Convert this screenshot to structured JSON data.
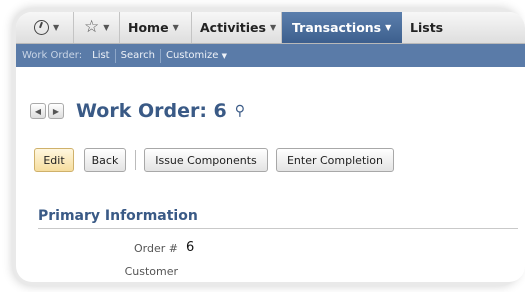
{
  "nav": {
    "items": [
      {
        "label": "Home"
      },
      {
        "label": "Activities"
      },
      {
        "label": "Transactions"
      },
      {
        "label": "Lists"
      }
    ]
  },
  "subnav": {
    "context_label": "Work Order:",
    "links": [
      "List",
      "Search",
      "Customize"
    ]
  },
  "record": {
    "title": "Work Order: 6"
  },
  "actions": {
    "edit": "Edit",
    "back": "Back",
    "issue_components": "Issue Components",
    "enter_completion": "Enter Completion"
  },
  "section": {
    "title": "Primary Information",
    "fields": [
      {
        "label": "Order #",
        "value": "6"
      },
      {
        "label": "Customer",
        "value": ""
      }
    ]
  }
}
